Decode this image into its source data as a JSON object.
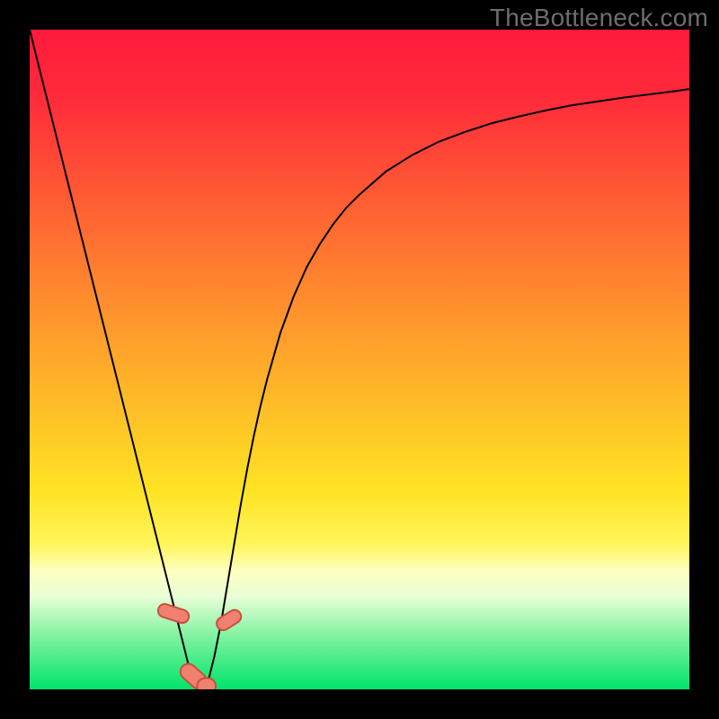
{
  "watermark": "TheBottleneck.com",
  "chart_data": {
    "type": "line",
    "title": "",
    "xlabel": "",
    "ylabel": "",
    "xlim": [
      0,
      1
    ],
    "ylim": [
      0,
      1
    ],
    "background_gradient": {
      "stops": [
        {
          "offset": 0.0,
          "color": "#ff1a3c"
        },
        {
          "offset": 0.1,
          "color": "#ff2a3a"
        },
        {
          "offset": 0.25,
          "color": "#ff5a34"
        },
        {
          "offset": 0.4,
          "color": "#ff8a2e"
        },
        {
          "offset": 0.55,
          "color": "#ffb728"
        },
        {
          "offset": 0.7,
          "color": "#ffe324"
        },
        {
          "offset": 0.78,
          "color": "#fff55a"
        },
        {
          "offset": 0.82,
          "color": "#ffffc0"
        },
        {
          "offset": 0.86,
          "color": "#e8ffd6"
        },
        {
          "offset": 0.92,
          "color": "#7ff2a0"
        },
        {
          "offset": 1.0,
          "color": "#00e46b"
        }
      ]
    },
    "series": [
      {
        "name": "curve",
        "color": "#000000",
        "stroke_width": 2,
        "x": [
          0.0,
          0.02,
          0.04,
          0.06,
          0.08,
          0.1,
          0.12,
          0.14,
          0.16,
          0.18,
          0.2,
          0.21,
          0.22,
          0.23,
          0.24,
          0.25,
          0.255,
          0.26,
          0.265,
          0.27,
          0.28,
          0.29,
          0.3,
          0.31,
          0.32,
          0.33,
          0.34,
          0.35,
          0.36,
          0.38,
          0.4,
          0.42,
          0.44,
          0.46,
          0.48,
          0.5,
          0.54,
          0.58,
          0.62,
          0.66,
          0.7,
          0.74,
          0.78,
          0.82,
          0.86,
          0.9,
          0.94,
          0.98,
          1.0
        ],
        "y": [
          1.0,
          0.92,
          0.84,
          0.76,
          0.68,
          0.6,
          0.52,
          0.44,
          0.36,
          0.28,
          0.2,
          0.16,
          0.12,
          0.08,
          0.04,
          0.01,
          0.0,
          0.0,
          0.0,
          0.01,
          0.05,
          0.1,
          0.16,
          0.22,
          0.28,
          0.335,
          0.385,
          0.43,
          0.47,
          0.54,
          0.595,
          0.64,
          0.675,
          0.705,
          0.73,
          0.75,
          0.785,
          0.81,
          0.83,
          0.845,
          0.858,
          0.868,
          0.877,
          0.885,
          0.891,
          0.897,
          0.902,
          0.907,
          0.91
        ]
      }
    ],
    "markers": [
      {
        "shape": "pill",
        "cx": 0.218,
        "cy": 0.115,
        "rx": 0.01,
        "ry": 0.024,
        "angle": -72,
        "fill": "#f08070",
        "stroke": "#c94f3e"
      },
      {
        "shape": "pill",
        "cx": 0.248,
        "cy": 0.02,
        "rx": 0.012,
        "ry": 0.022,
        "angle": -48,
        "fill": "#f08070",
        "stroke": "#c94f3e"
      },
      {
        "shape": "pill",
        "cx": 0.268,
        "cy": 0.005,
        "rx": 0.014,
        "ry": 0.012,
        "angle": 0,
        "fill": "#f08070",
        "stroke": "#c94f3e"
      },
      {
        "shape": "pill",
        "cx": 0.302,
        "cy": 0.105,
        "rx": 0.01,
        "ry": 0.02,
        "angle": 58,
        "fill": "#f08070",
        "stroke": "#c94f3e"
      }
    ]
  }
}
